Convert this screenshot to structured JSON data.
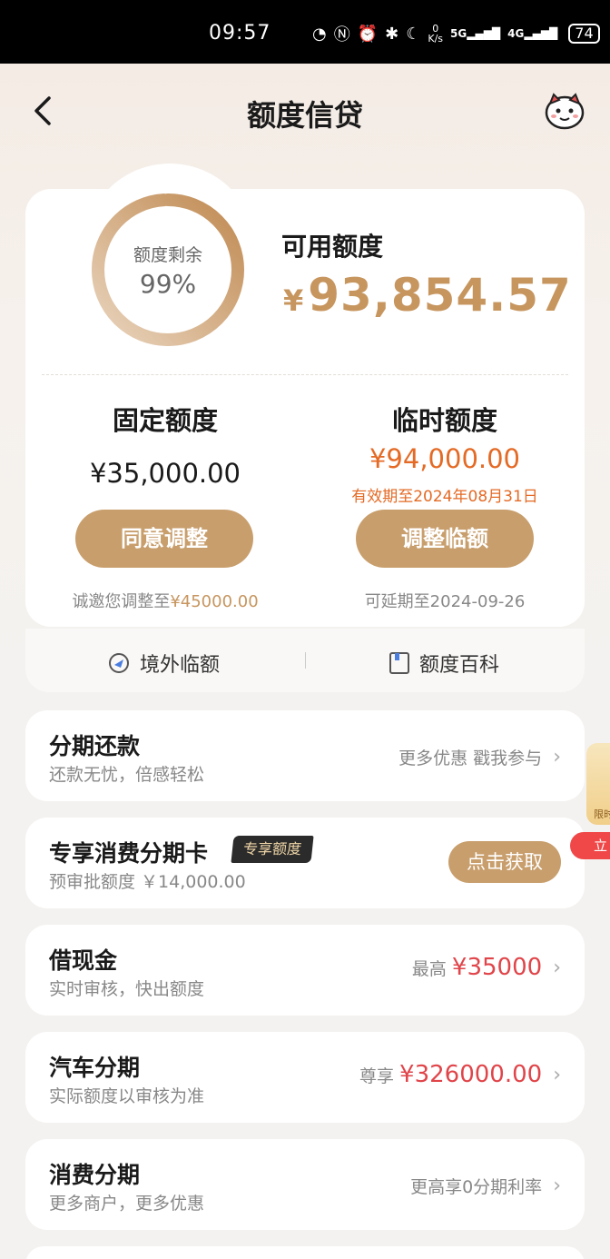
{
  "status_bar": {
    "time": "09:57",
    "net_speed_top": "0",
    "net_speed_unit": "K/s",
    "sig1": "5G",
    "sig2": "4G",
    "battery": "74"
  },
  "nav": {
    "title": "额度信贷"
  },
  "summary": {
    "ring_label": "额度剩余",
    "ring_value": "99%",
    "ring_fraction": 0.99,
    "available_label": "可用额度",
    "available_currency": "¥",
    "available_amount": "93,854.57"
  },
  "fixed": {
    "title": "固定额度",
    "amount": "¥35,000.00",
    "button": "同意调整",
    "note_prefix": "诚邀您调整至",
    "note_value": "¥45000.00"
  },
  "temp": {
    "title": "临时额度",
    "amount": "¥94,000.00",
    "validity": "有效期至2024年08月31日",
    "button": "调整临额",
    "note": "可延期至2024-09-26"
  },
  "quick": {
    "left": "境外临额",
    "right": "额度百科"
  },
  "rows": {
    "installment": {
      "title": "分期还款",
      "sub": "还款无忧，倍感轻松",
      "right": "更多优惠 戳我参与"
    },
    "card": {
      "title": "专享消费分期卡",
      "badge": "专享额度",
      "sub": "预审批额度 ￥14,000.00",
      "button": "点击获取"
    },
    "cash": {
      "title": "借现金",
      "sub": "实时审核，快出额度",
      "right_prefix": "最高",
      "right_value": "¥35000"
    },
    "car": {
      "title": "汽车分期",
      "sub": "实际额度以审核为准",
      "right_prefix": "尊享",
      "right_value": "¥326000.00"
    },
    "consume": {
      "title": "消费分期",
      "sub": "更多商户，更多优惠",
      "right": "更高享0分期利率"
    }
  },
  "side": {
    "promo": "限时",
    "red": "立"
  },
  "colors": {
    "gold": "#c89e6c",
    "orange": "#e46a25",
    "red": "#e0454a"
  }
}
